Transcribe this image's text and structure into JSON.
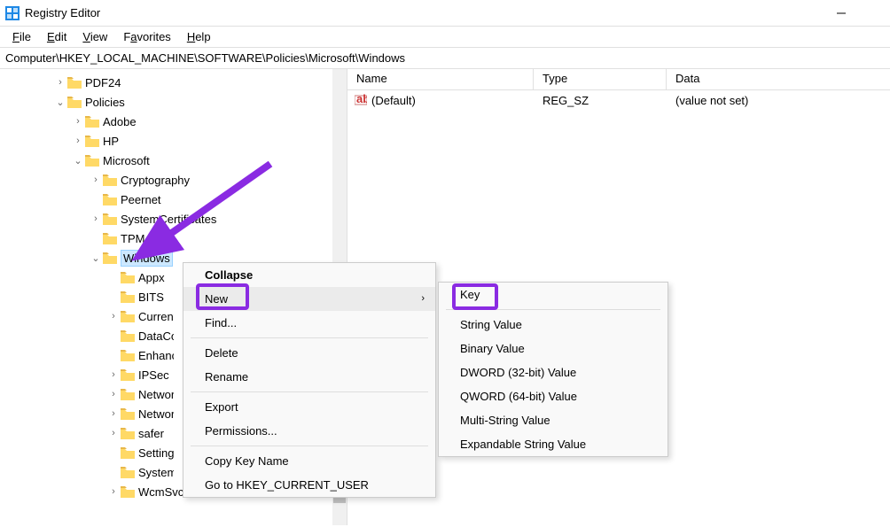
{
  "window": {
    "title": "Registry Editor"
  },
  "menu": {
    "file": "File",
    "edit": "Edit",
    "view": "View",
    "favorites": "Favorites",
    "help": "Help"
  },
  "addressbar": "Computer\\HKEY_LOCAL_MACHINE\\SOFTWARE\\Policies\\Microsoft\\Windows",
  "tree": {
    "pdf24": "PDF24",
    "policies": "Policies",
    "adobe": "Adobe",
    "hp": "HP",
    "microsoft": "Microsoft",
    "cryptography": "Cryptography",
    "peernet": "Peernet",
    "systemcertificates": "SystemCertificates",
    "tpm": "TPM",
    "windows": "Windows",
    "appx": "Appx",
    "bits": "BITS",
    "currentversion": "CurrentVersion",
    "datacollection": "DataCollection",
    "enhancedstorage": "EnhancedStorage",
    "ipsec": "IPSec",
    "networkconn": "NetworkConnectivityStatusIndicator",
    "networkprov": "NetworkProvisioning",
    "safer": "safer",
    "settingsync": "SettingSync",
    "system": "System",
    "wcmsvc": "WcmSvc"
  },
  "columns": {
    "name": "Name",
    "type": "Type",
    "data": "Data"
  },
  "values": [
    {
      "name": "(Default)",
      "type": "REG_SZ",
      "data": "(value not set)"
    }
  ],
  "ctx": {
    "collapse": "Collapse",
    "new": "New",
    "find": "Find...",
    "delete": "Delete",
    "rename": "Rename",
    "export": "Export",
    "permissions": "Permissions...",
    "copykey": "Copy Key Name",
    "goto": "Go to HKEY_CURRENT_USER"
  },
  "newmenu": {
    "key": "Key",
    "string": "String Value",
    "binary": "Binary Value",
    "dword": "DWORD (32-bit) Value",
    "qword": "QWORD (64-bit) Value",
    "multistring": "Multi-String Value",
    "expandable": "Expandable String Value"
  }
}
